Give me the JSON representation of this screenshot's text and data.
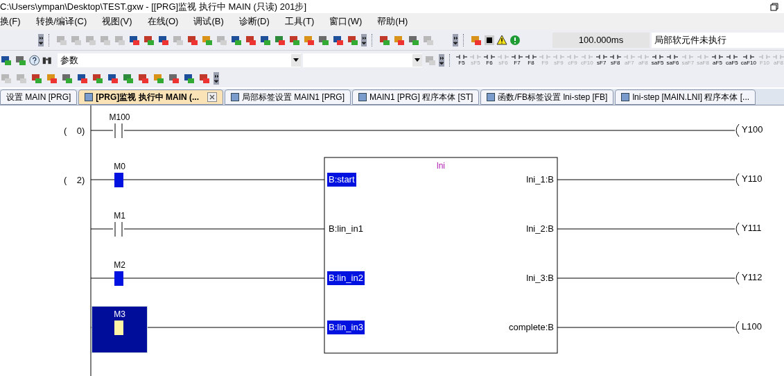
{
  "window": {
    "title": "C:\\Users\\ympan\\Desktop\\TEST.gxw - [[PRG]监视 执行中 MAIN (只读) 201步]"
  },
  "menu": [
    "换(F)",
    "转换/编译(C)",
    "视图(V)",
    "在线(O)",
    "调试(B)",
    "诊断(D)",
    "工具(T)",
    "窗口(W)",
    "帮助(H)"
  ],
  "monitor_status": {
    "scan_time": "100.000ms",
    "message": "局部软元件未执行"
  },
  "search_bar": {
    "value": "参数"
  },
  "function_keys": [
    {
      "label": "F5",
      "disabled": false
    },
    {
      "label": "sF5",
      "disabled": true
    },
    {
      "label": "F6",
      "disabled": false
    },
    {
      "label": "sF6",
      "disabled": true
    },
    {
      "label": "F7",
      "disabled": false
    },
    {
      "label": "F8",
      "disabled": false
    },
    {
      "label": "F9",
      "disabled": true
    },
    {
      "label": "sF9",
      "disabled": true
    },
    {
      "label": "cF9",
      "disabled": true
    },
    {
      "label": "cF10",
      "disabled": true
    },
    {
      "label": "sF7",
      "disabled": false
    },
    {
      "label": "sF8",
      "disabled": false
    },
    {
      "label": "aF7",
      "disabled": true
    },
    {
      "label": "aF8",
      "disabled": true
    },
    {
      "label": "saF5",
      "disabled": false
    },
    {
      "label": "saF6",
      "disabled": false
    },
    {
      "label": "saF7",
      "disabled": true
    },
    {
      "label": "saF8",
      "disabled": true
    },
    {
      "label": "aF5",
      "disabled": false
    },
    {
      "label": "caF5",
      "disabled": false
    },
    {
      "label": "caF10",
      "disabled": false
    },
    {
      "label": "F10",
      "disabled": true
    },
    {
      "label": "aF8",
      "disabled": true
    }
  ],
  "tabs": [
    {
      "label": "设置 MAIN [PRG]",
      "selected": false
    },
    {
      "label": "[PRG]监视 执行中 MAIN (...",
      "selected": true
    },
    {
      "label": "局部标签设置 MAIN1 [PRG]",
      "selected": false
    },
    {
      "label": "MAIN1 [PRG] 程序本体 [ST]",
      "selected": false
    },
    {
      "label": "函数/FB标签设置 lni-step [FB]",
      "selected": false
    },
    {
      "label": "lni-step [MAIN.LNI] 程序本体 [...",
      "selected": false
    }
  ],
  "ladder": {
    "function_block": {
      "name": "lni"
    },
    "rows": [
      {
        "step": "(    0)",
        "contact": {
          "label": "M100",
          "on": false,
          "selected": false
        },
        "coil": "Y100"
      },
      {
        "step": "(    2)",
        "contact": {
          "label": "M0",
          "on": true,
          "selected": false
        },
        "fb_input": {
          "label": "B:start",
          "on": true
        },
        "fb_output": "lni_1:B",
        "coil": "Y110"
      },
      {
        "contact": {
          "label": "M1",
          "on": false,
          "selected": false
        },
        "fb_input": {
          "label": "B:lin_in1",
          "on": false
        },
        "fb_output": "lni_2:B",
        "coil": "Y111"
      },
      {
        "contact": {
          "label": "M2",
          "on": true,
          "selected": false
        },
        "fb_input": {
          "label": "B:lin_in2",
          "on": true
        },
        "fb_output": "lni_3:B",
        "coil": "Y112"
      },
      {
        "contact": {
          "label": "M3",
          "on": true,
          "selected": true
        },
        "fb_input": {
          "label": "B:lin_in3",
          "on": true
        },
        "fb_output": "complete:B",
        "coil": "L100"
      }
    ]
  }
}
